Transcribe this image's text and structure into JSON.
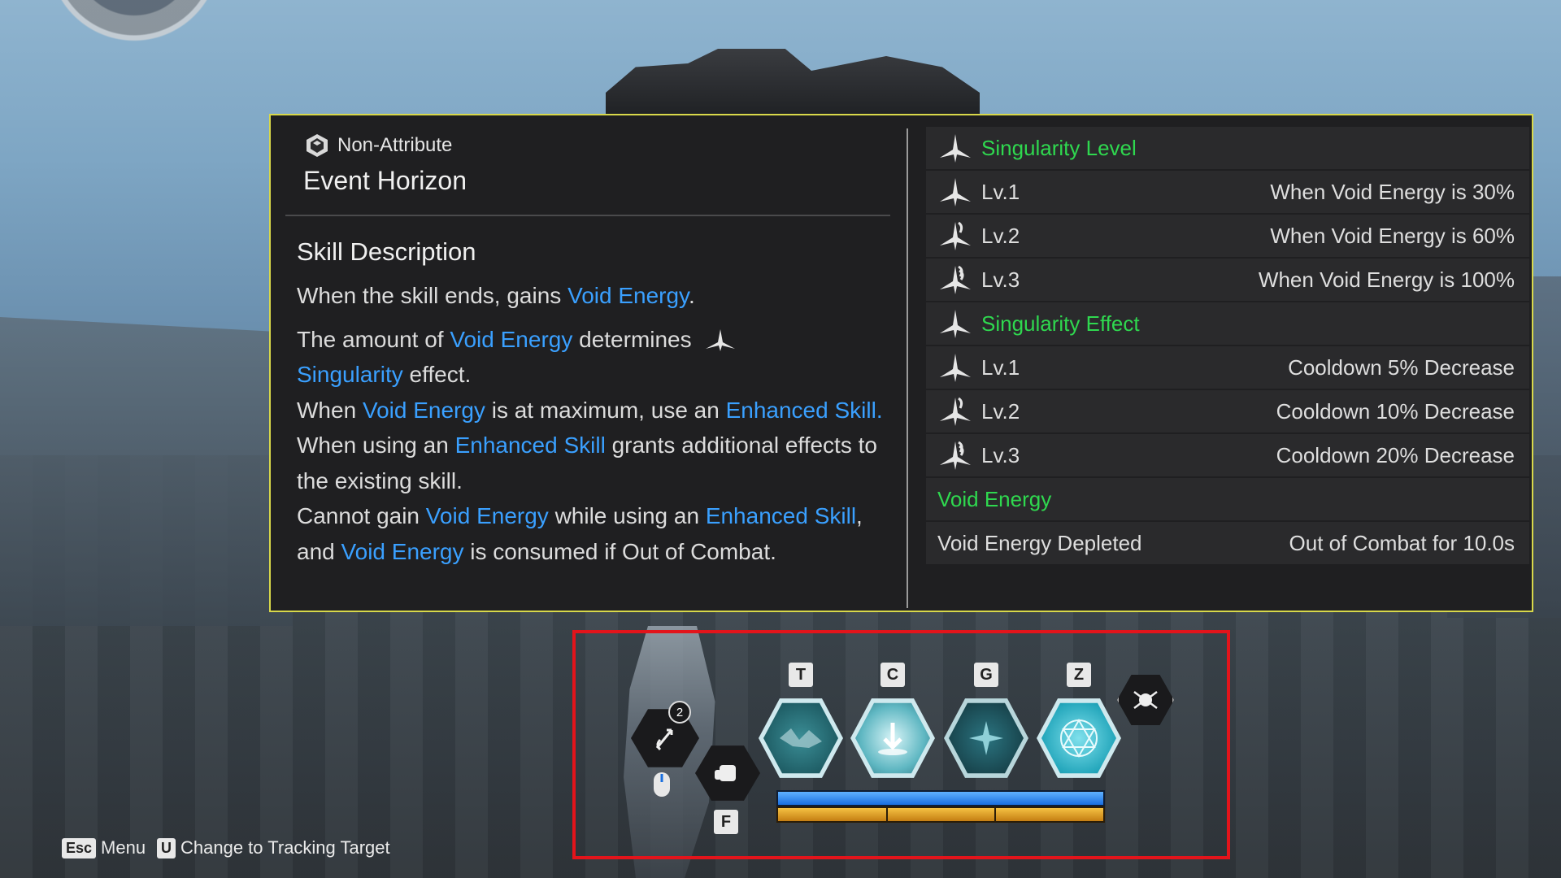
{
  "tooltip": {
    "attribute": "Non-Attribute",
    "skill_name": "Event Horizon",
    "desc_title": "Skill Description",
    "desc": {
      "p1": {
        "a": "When the skill ends, gains ",
        "hl1": "Void Energy",
        "b": "."
      },
      "p2": {
        "a": "The amount of ",
        "hl1": "Void Energy",
        "b": " determines ",
        "hl2": "Singularity",
        "c": " effect.",
        "d": "When ",
        "hl3": "Void Energy",
        "e": " is at maximum, use an ",
        "hl4": "Enhanced Skill.",
        "f": " When using an ",
        "hl5": "Enhanced Skill",
        "g": " grants additional effects to the existing skill.",
        "h": "Cannot gain ",
        "hl6": "Void Energy",
        "i": " while using an ",
        "hl7": "Enhanced Skill",
        "j": ", and ",
        "hl8": "Void Energy",
        "k": " is consumed if Out of Combat."
      }
    },
    "singularity_level": {
      "title": "Singularity Level",
      "rows": [
        {
          "lv": "Lv.1",
          "val": "When Void Energy is 30%"
        },
        {
          "lv": "Lv.2",
          "val": "When Void Energy is 60%"
        },
        {
          "lv": "Lv.3",
          "val": "When Void Energy is 100%"
        }
      ]
    },
    "singularity_effect": {
      "title": "Singularity Effect",
      "rows": [
        {
          "lv": "Lv.1",
          "val": "Cooldown 5% Decrease"
        },
        {
          "lv": "Lv.2",
          "val": "Cooldown 10% Decrease"
        },
        {
          "lv": "Lv.3",
          "val": "Cooldown 20% Decrease"
        }
      ]
    },
    "void_energy": {
      "title": "Void Energy",
      "label": "Void Energy Depleted",
      "val": "Out of Combat for 10.0s"
    }
  },
  "skillbar": {
    "grapple_count": "2",
    "keys": {
      "t": "T",
      "c": "C",
      "g": "G",
      "z": "Z",
      "f": "F"
    },
    "hp_fraction": 1.0,
    "shield_fraction": 1.0
  },
  "hints": {
    "menu_key": "Esc",
    "menu_label": "Menu",
    "track_key": "U",
    "track_label": "Change to Tracking Target"
  },
  "colors": {
    "highlight_blue": "#3aa0ff",
    "header_green": "#2fd84f",
    "tooltip_border": "#d8d84a",
    "selection_box": "#e3141b"
  }
}
